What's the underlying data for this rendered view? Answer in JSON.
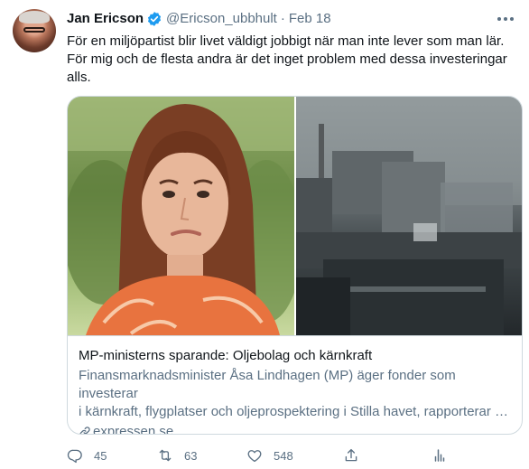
{
  "tweet": {
    "author_name": "Jan Ericson",
    "handle": "@Ericson_ubbhult",
    "separator": "·",
    "date": "Feb 18",
    "text_lines": [
      "För en miljöpartist blir livet väldigt jobbigt när man inte lever som man lär.",
      "För mig och de flesta andra är det inget problem med dessa investeringar",
      "alls."
    ]
  },
  "card": {
    "title": "MP-ministerns sparande: Oljebolag och kärnkraft",
    "description_lines": [
      "Finansmarknadsminister Åsa Lindhagen (MP) äger fonder som investerar",
      "i kärnkraft, flygplatser och oljeprospektering i Stilla havet, rapporterar …"
    ],
    "domain": "expressen.se"
  },
  "actions": {
    "reply_count": "45",
    "retweet_count": "63",
    "like_count": "548"
  },
  "icons": {
    "verified": "verified-badge-icon",
    "more": "more-icon",
    "link": "link-icon",
    "reply": "reply-icon",
    "retweet": "retweet-icon",
    "like": "like-icon",
    "share": "share-icon",
    "analytics": "analytics-icon"
  },
  "colors": {
    "text": "#0f1419",
    "secondary": "#5b7083",
    "verified": "#1d9bf0",
    "border": "#cfd9de"
  }
}
